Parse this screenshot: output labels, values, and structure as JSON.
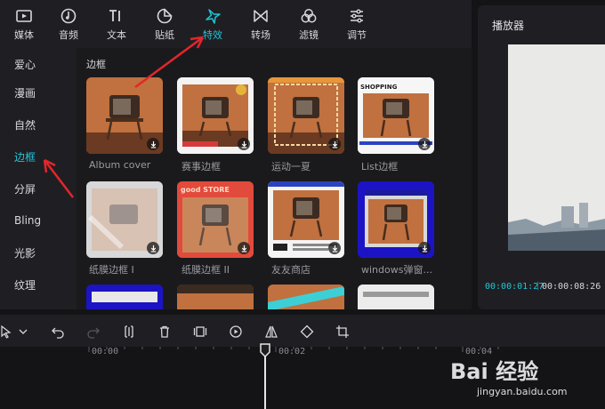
{
  "toolbar": {
    "items": [
      {
        "label": "媒体",
        "icon": "media-icon"
      },
      {
        "label": "音频",
        "icon": "audio-icon"
      },
      {
        "label": "文本",
        "icon": "text-icon"
      },
      {
        "label": "贴纸",
        "icon": "sticker-icon"
      },
      {
        "label": "特效",
        "icon": "effects-icon"
      },
      {
        "label": "转场",
        "icon": "transition-icon"
      },
      {
        "label": "滤镜",
        "icon": "filter-icon"
      },
      {
        "label": "调节",
        "icon": "adjust-icon"
      }
    ],
    "active": "特效",
    "accent_color": "#1fc6d8"
  },
  "sidebar": {
    "items": [
      {
        "label": "爱心"
      },
      {
        "label": "漫画"
      },
      {
        "label": "自然"
      },
      {
        "label": "边框"
      },
      {
        "label": "分屏"
      },
      {
        "label": "Bling"
      },
      {
        "label": "光影"
      },
      {
        "label": "纹理"
      }
    ],
    "active": "边框"
  },
  "content": {
    "section_title": "边框",
    "tiles": [
      {
        "label": "Album cover"
      },
      {
        "label": "赛事边框"
      },
      {
        "label": "运动一夏"
      },
      {
        "label": "List边框"
      },
      {
        "label": "纸膜边框 I"
      },
      {
        "label": "纸膜边框 II"
      },
      {
        "label": "友友商店"
      },
      {
        "label": "windows弹窗..."
      }
    ]
  },
  "player": {
    "title": "播放器",
    "current_time": "00:00:01:27",
    "separator": "|",
    "total_time": "00:00:08:26"
  },
  "timeline": {
    "ruler": [
      "00:00",
      "00:02",
      "00:04"
    ]
  },
  "watermark": {
    "text": "Bai 经验",
    "url": "jingyan.baidu.com"
  }
}
